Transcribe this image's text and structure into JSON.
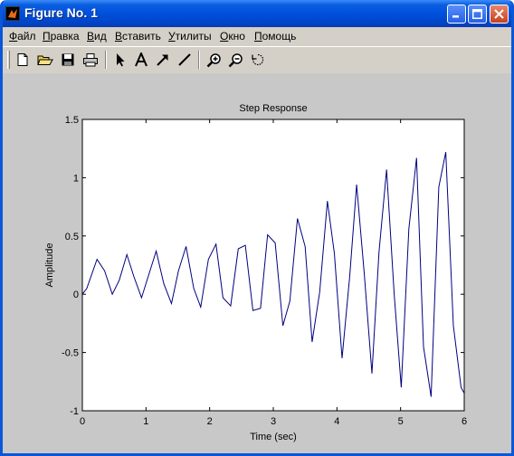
{
  "window": {
    "title": "Figure No. 1"
  },
  "menu": [
    {
      "key": "Ф",
      "rest": "айл"
    },
    {
      "key": "П",
      "rest": "равка"
    },
    {
      "key": "В",
      "rest": "ид"
    },
    {
      "key": "В",
      "rest": "ставить"
    },
    {
      "key": "У",
      "rest": "тилиты"
    },
    {
      "key": "О",
      "rest": "кно"
    },
    {
      "key": "П",
      "rest": "омощь"
    }
  ],
  "toolbar": {
    "icons": [
      "new-file-icon",
      "open-folder-icon",
      "save-icon",
      "print-icon",
      "select-arrow-icon",
      "text-icon",
      "arrow-icon",
      "line-icon",
      "zoom-in-icon",
      "zoom-out-icon",
      "rotate-icon"
    ]
  },
  "chart_data": {
    "type": "line",
    "title": "Step Response",
    "xlabel": "Time (sec)",
    "ylabel": "Amplitude",
    "xlim": [
      0,
      6
    ],
    "ylim": [
      -1,
      1.5
    ],
    "xticks": [
      "0",
      "1",
      "2",
      "3",
      "4",
      "5",
      "6"
    ],
    "yticks": [
      "-1",
      "-0.5",
      "0",
      "0.5",
      "1",
      "1.5"
    ],
    "line_color": "#00007f",
    "series": [
      {
        "x": [
          0,
          0.07,
          0.23,
          0.35,
          0.47,
          0.58,
          0.7,
          0.81,
          0.93,
          1.05,
          1.16,
          1.28,
          1.4,
          1.51,
          1.63,
          1.75,
          1.86,
          1.98,
          2.1,
          2.21,
          2.33,
          2.45,
          2.56,
          2.68,
          2.8,
          2.91,
          3.03,
          3.15,
          3.26,
          3.38,
          3.5,
          3.61,
          3.73,
          3.85,
          3.96,
          4.08,
          4.2,
          4.31,
          4.43,
          4.55,
          4.66,
          4.78,
          4.9,
          5.01,
          5.13,
          5.25,
          5.36,
          5.48,
          5.6,
          5.71,
          5.83,
          5.95,
          6.0
        ],
        "y": [
          0,
          0.05,
          0.3,
          0.2,
          0.0,
          0.12,
          0.34,
          0.15,
          -0.03,
          0.18,
          0.37,
          0.09,
          -0.08,
          0.2,
          0.41,
          0.05,
          -0.11,
          0.3,
          0.43,
          -0.03,
          -0.1,
          0.39,
          0.42,
          -0.14,
          -0.12,
          0.51,
          0.44,
          -0.27,
          -0.06,
          0.65,
          0.41,
          -0.41,
          0.02,
          0.8,
          0.35,
          -0.55,
          0.15,
          0.94,
          0.17,
          -0.68,
          0.36,
          1.07,
          0.0,
          -0.8,
          0.56,
          1.17,
          -0.45,
          -0.88,
          0.92,
          1.22,
          -0.27,
          -0.8,
          -0.85
        ]
      }
    ]
  }
}
